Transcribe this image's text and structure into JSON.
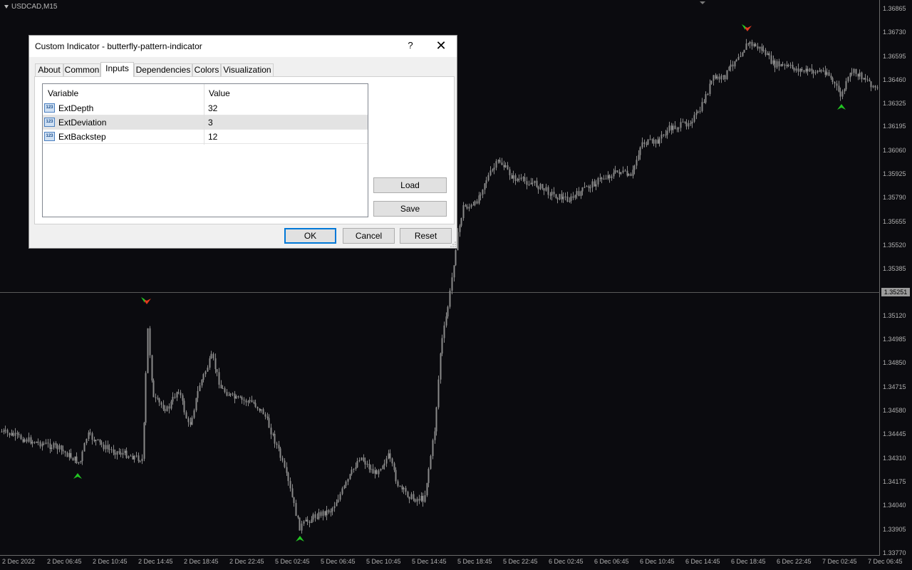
{
  "chart": {
    "symbol": "USDCAD,M15",
    "price_axis": [
      "1.36865",
      "1.36730",
      "1.36595",
      "1.36460",
      "1.36325",
      "1.36195",
      "1.36060",
      "1.35925",
      "1.35790",
      "1.35655",
      "1.35520",
      "1.35385",
      "1.35120",
      "1.34985",
      "1.34850",
      "1.34715",
      "1.34580",
      "1.34445",
      "1.34310",
      "1.34175",
      "1.34040",
      "1.33905",
      "1.33770"
    ],
    "current_price": "1.35251",
    "time_axis": [
      "2 Dec 2022",
      "2 Dec 06:45",
      "2 Dec 10:45",
      "2 Dec 14:45",
      "2 Dec 18:45",
      "2 Dec 22:45",
      "5 Dec 02:45",
      "5 Dec 06:45",
      "5 Dec 10:45",
      "5 Dec 14:45",
      "5 Dec 18:45",
      "5 Dec 22:45",
      "6 Dec 02:45",
      "6 Dec 06:45",
      "6 Dec 10:45",
      "6 Dec 14:45",
      "6 Dec 18:45",
      "6 Dec 22:45",
      "7 Dec 02:45",
      "7 Dec 06:45"
    ],
    "colors": {
      "background": "#0b0b0f",
      "candle": "#8a8a8a",
      "grid_line": "#5a5a5a",
      "arrow_up": "#22c522",
      "arrow_down": "#e03a1e"
    }
  },
  "dialog": {
    "title": "Custom Indicator - butterfly-pattern-indicator",
    "help_label": "?",
    "close_label": "✕",
    "tabs": [
      "About",
      "Common",
      "Inputs",
      "Dependencies",
      "Colors",
      "Visualization"
    ],
    "active_tab": "Inputs",
    "table": {
      "headers": [
        "Variable",
        "Value"
      ],
      "rows": [
        {
          "variable": "ExtDepth",
          "value": "32"
        },
        {
          "variable": "ExtDeviation",
          "value": "3"
        },
        {
          "variable": "ExtBackstep",
          "value": "12"
        }
      ]
    },
    "buttons": {
      "load": "Load",
      "save": "Save",
      "ok": "OK",
      "cancel": "Cancel",
      "reset": "Reset"
    }
  }
}
